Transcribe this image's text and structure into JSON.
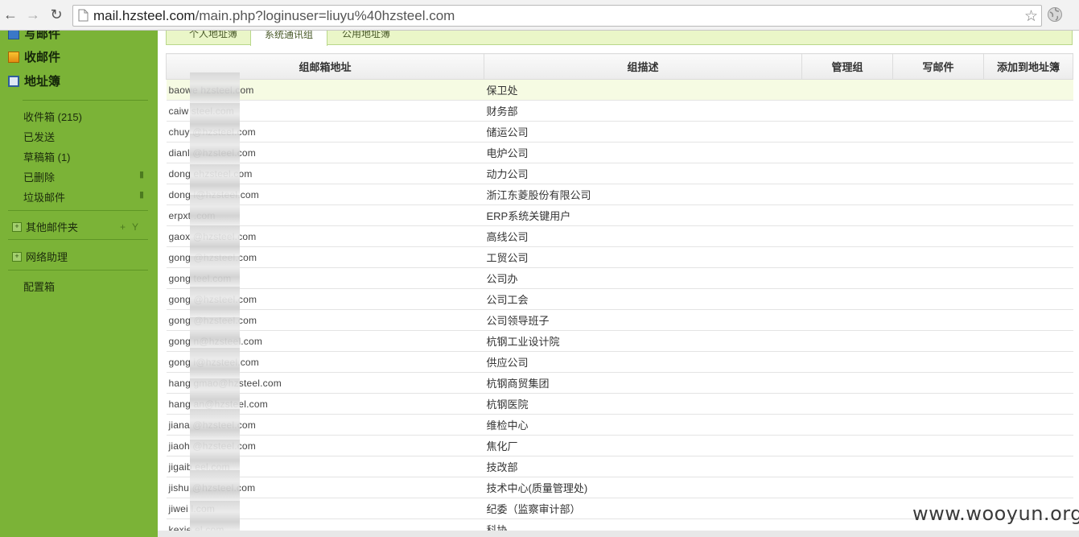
{
  "browser": {
    "url_host": "mail.hzsteel.com",
    "url_rest": "/main.php?loginuser=liuyu%40hzsteel.com",
    "icons": [
      "back-arrow-icon",
      "forward-arrow-icon",
      "reload-icon",
      "page-icon",
      "star-icon",
      "globe-icon"
    ]
  },
  "sidebar": {
    "main_items": [
      {
        "label": "写邮件",
        "icon": "compose-icon"
      },
      {
        "label": "收邮件",
        "icon": "receive-icon"
      },
      {
        "label": "地址簿",
        "icon": "address-book-icon"
      }
    ],
    "folders": [
      {
        "label": "收件箱 (215)"
      },
      {
        "label": "已发送"
      },
      {
        "label": "草稿箱 (1)"
      },
      {
        "label": "已删除"
      },
      {
        "label": "垃圾邮件"
      }
    ],
    "groups": [
      {
        "label": "其他邮件夹"
      },
      {
        "label": "网络助理"
      }
    ],
    "settings_label": "配置箱"
  },
  "tabs": [
    {
      "label": "个人地址簿"
    },
    {
      "label": "系统通讯组"
    },
    {
      "label": "公用地址簿"
    }
  ],
  "table": {
    "headers": [
      "组邮箱地址",
      "组描述",
      "管理组",
      "写邮件",
      "添加到地址簿"
    ],
    "rows": [
      {
        "email": "baowe        hzsteel.com",
        "desc": "保卫处"
      },
      {
        "email": "caiw              steel.com",
        "desc": "财务部"
      },
      {
        "email": "chuy                @hzsteel.com",
        "desc": "储运公司"
      },
      {
        "email": "dianl              @hzsteel.com",
        "desc": "电炉公司"
      },
      {
        "email": "dong              ehzsteel.com",
        "desc": "动力公司"
      },
      {
        "email": "dong               i@hzsteel.com",
        "desc": "浙江东菱股份有限公司"
      },
      {
        "email": "erpxt                .com",
        "desc": "ERP系统关键用户"
      },
      {
        "email": "gaox                @hzsteel.com",
        "desc": "高线公司"
      },
      {
        "email": "gong                  @hzsteel.com",
        "desc": "工贸公司"
      },
      {
        "email": "gong                teel.com",
        "desc": "公司办"
      },
      {
        "email": "gong                @hzsteel.com",
        "desc": "公司工会"
      },
      {
        "email": "gong               @hzsteel.com",
        "desc": "公司领导班子"
      },
      {
        "email": "gong                   n@hzsteel.com",
        "desc": "杭钢工业设计院"
      },
      {
        "email": "gong                i@hzsteel.com",
        "desc": "供应公司"
      },
      {
        "email": "hang                  gmao@hzsteel.com",
        "desc": "杭钢商贸集团"
      },
      {
        "email": "hang                 an@hzsteel.com",
        "desc": "杭钢医院"
      },
      {
        "email": "jiana               @hzsteel.com",
        "desc": "维检中心"
      },
      {
        "email": "jiaoh               @hzsteel.com",
        "desc": "焦化厂"
      },
      {
        "email": "jigaib             eel.com",
        "desc": "技改部"
      },
      {
        "email": "jishu               @hzsteel.com",
        "desc": "技术中心(质量管理处)"
      },
      {
        "email": "jiwei              l.com",
        "desc": "纪委（监察审计部）"
      },
      {
        "email": "kexie             el.com",
        "desc": "科协"
      }
    ]
  },
  "watermark": "www.wooyun.org",
  "colors": {
    "sidebar": "#7bb337",
    "tabbar": "#eaf6c8",
    "highlight_row": "#f6fbe3"
  }
}
